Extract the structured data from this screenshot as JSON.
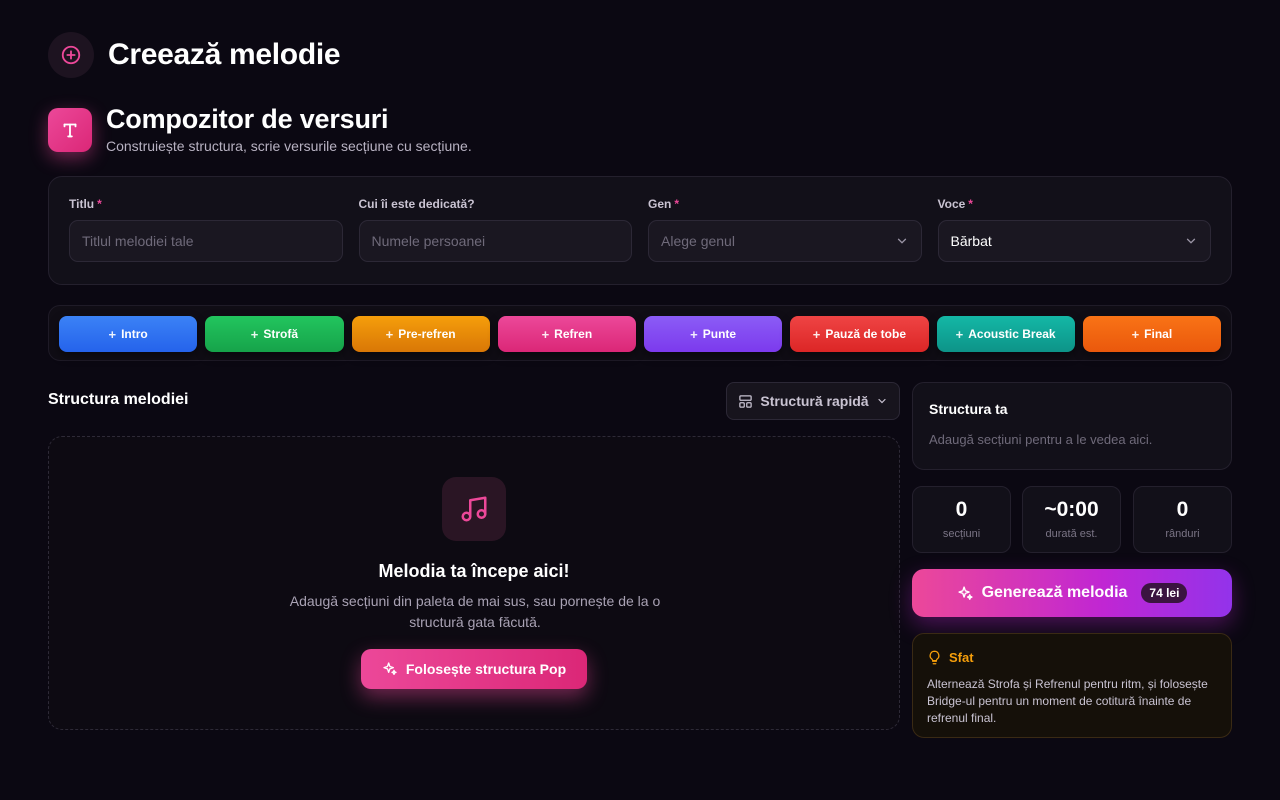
{
  "header": {
    "title": "Creează melodie"
  },
  "composer": {
    "title": "Compozitor de versuri",
    "subtitle": "Construiește structura, scrie versurile secțiune cu secțiune.",
    "badge_letter": "T"
  },
  "form": {
    "title": {
      "label": "Titlu",
      "required": "*",
      "placeholder": "Titlul melodiei tale"
    },
    "dedication": {
      "label": "Cui îi este dedicată?",
      "placeholder": "Numele persoanei"
    },
    "genre": {
      "label": "Gen",
      "required": "*",
      "placeholder": "Alege genul"
    },
    "voice": {
      "label": "Voce",
      "required": "*",
      "value": "Bărbat"
    }
  },
  "palette": [
    {
      "label": "Intro",
      "color": "#3b82f6"
    },
    {
      "label": "Strofă",
      "color": "#22c55e"
    },
    {
      "label": "Pre-refren",
      "color": "#f59e0b"
    },
    {
      "label": "Refren",
      "color": "#ec4899"
    },
    {
      "label": "Punte",
      "color": "#8b5cf6"
    },
    {
      "label": "Pauză de tobe",
      "color": "#ef4444"
    },
    {
      "label": "Acoustic Break",
      "color": "#14b8a6"
    },
    {
      "label": "Final",
      "color": "#f97316"
    }
  ],
  "structure": {
    "title": "Structura melodiei",
    "quick_label": "Structură rapidă",
    "empty_title": "Melodia ta începe aici!",
    "empty_text": "Adaugă secțiuni din paleta de mai sus, sau pornește de la o structură gata făcută.",
    "pop_button": "Folosește structura Pop"
  },
  "sidebar": {
    "your_structure_title": "Structura ta",
    "your_structure_text": "Adaugă secțiuni pentru a le vedea aici.",
    "stats": [
      {
        "value": "0",
        "label": "secțiuni"
      },
      {
        "value": "~0:00",
        "label": "durată est."
      },
      {
        "value": "0",
        "label": "rânduri"
      }
    ],
    "generate_label": "Generează melodia",
    "price": "74 lei",
    "tip_title": "Sfat",
    "tip_text": "Alternează Strofa și Refrenul pentru ritm, și folosește Bridge-ul pentru un moment de cotitură înainte de refrenul final."
  },
  "colors": {
    "accent": "#ec4899",
    "background": "#0b0812",
    "tip": "#f59e0b"
  }
}
